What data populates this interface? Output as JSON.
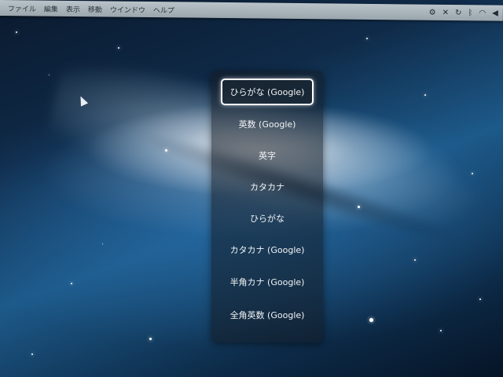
{
  "menubar": {
    "items": [
      "ファイル",
      "編集",
      "表示",
      "移動",
      "ウインドウ",
      "ヘルプ"
    ],
    "status_icons": [
      "wrench-icon",
      "x-icon",
      "sync-icon",
      "bluetooth-icon",
      "wifi-icon",
      "volume-icon"
    ]
  },
  "ime_palette": {
    "items": [
      {
        "label": "ひらがな (Google)",
        "selected": true
      },
      {
        "label": "英数 (Google)",
        "selected": false
      },
      {
        "label": "英字",
        "selected": false
      },
      {
        "label": "カタカナ",
        "selected": false
      },
      {
        "label": "ひらがな",
        "selected": false
      },
      {
        "label": "カタカナ (Google)",
        "selected": false
      },
      {
        "label": "半角カナ (Google)",
        "selected": false
      },
      {
        "label": "全角英数 (Google)",
        "selected": false
      }
    ]
  },
  "colors": {
    "palette_text": "#f2f4f6",
    "selected_border": "#ffffff"
  }
}
